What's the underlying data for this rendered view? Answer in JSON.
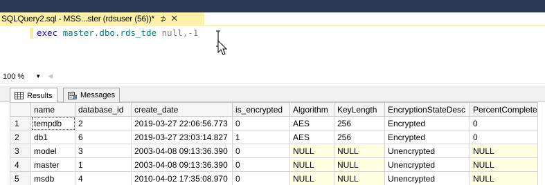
{
  "tab": {
    "title": "SQLQuery2.sql - MSS...ster (rdsuser (56))*",
    "pin_glyph": "⊅",
    "close_glyph": "✕"
  },
  "editor": {
    "code_keyword": "exec",
    "code_object": "master.dbo.rds_tde",
    "code_null": "null",
    "code_rest": ",-1"
  },
  "zoom": {
    "value": "100 %",
    "caret": "▼",
    "scroll_arrow": "◀"
  },
  "result_tabs": [
    {
      "label": "Results",
      "icon": "grid-icon"
    },
    {
      "label": "Messages",
      "icon": "messages-icon"
    }
  ],
  "grid": {
    "columns": [
      "",
      "name",
      "database_id",
      "create_date",
      "is_encrypted",
      "Algorithm",
      "KeyLength",
      "EncryptionStateDesc",
      "PercentComplete"
    ],
    "rows": [
      [
        "1",
        "tempdb",
        "2",
        "2019-03-27 22:06:56.773",
        "0",
        "AES",
        "256",
        "Encrypted",
        "0"
      ],
      [
        "2",
        "db1",
        "6",
        "2019-03-27 23:03:14.827",
        "1",
        "AES",
        "256",
        "Encrypted",
        "0"
      ],
      [
        "3",
        "model",
        "3",
        "2003-04-08 09:13:36.390",
        "0",
        "NULL",
        "NULL",
        "Unencrypted",
        "NULL"
      ],
      [
        "4",
        "master",
        "1",
        "2003-04-08 09:13:36.390",
        "0",
        "NULL",
        "NULL",
        "Unencrypted",
        "NULL"
      ],
      [
        "5",
        "msdb",
        "4",
        "2010-04-02 17:35:08.970",
        "0",
        "NULL",
        "NULL",
        "Unencrypted",
        "NULL"
      ]
    ]
  },
  "colors": {
    "tab_active": "#fff1a8",
    "top_strip": "#293955",
    "null_cell": "#ffffe1"
  }
}
